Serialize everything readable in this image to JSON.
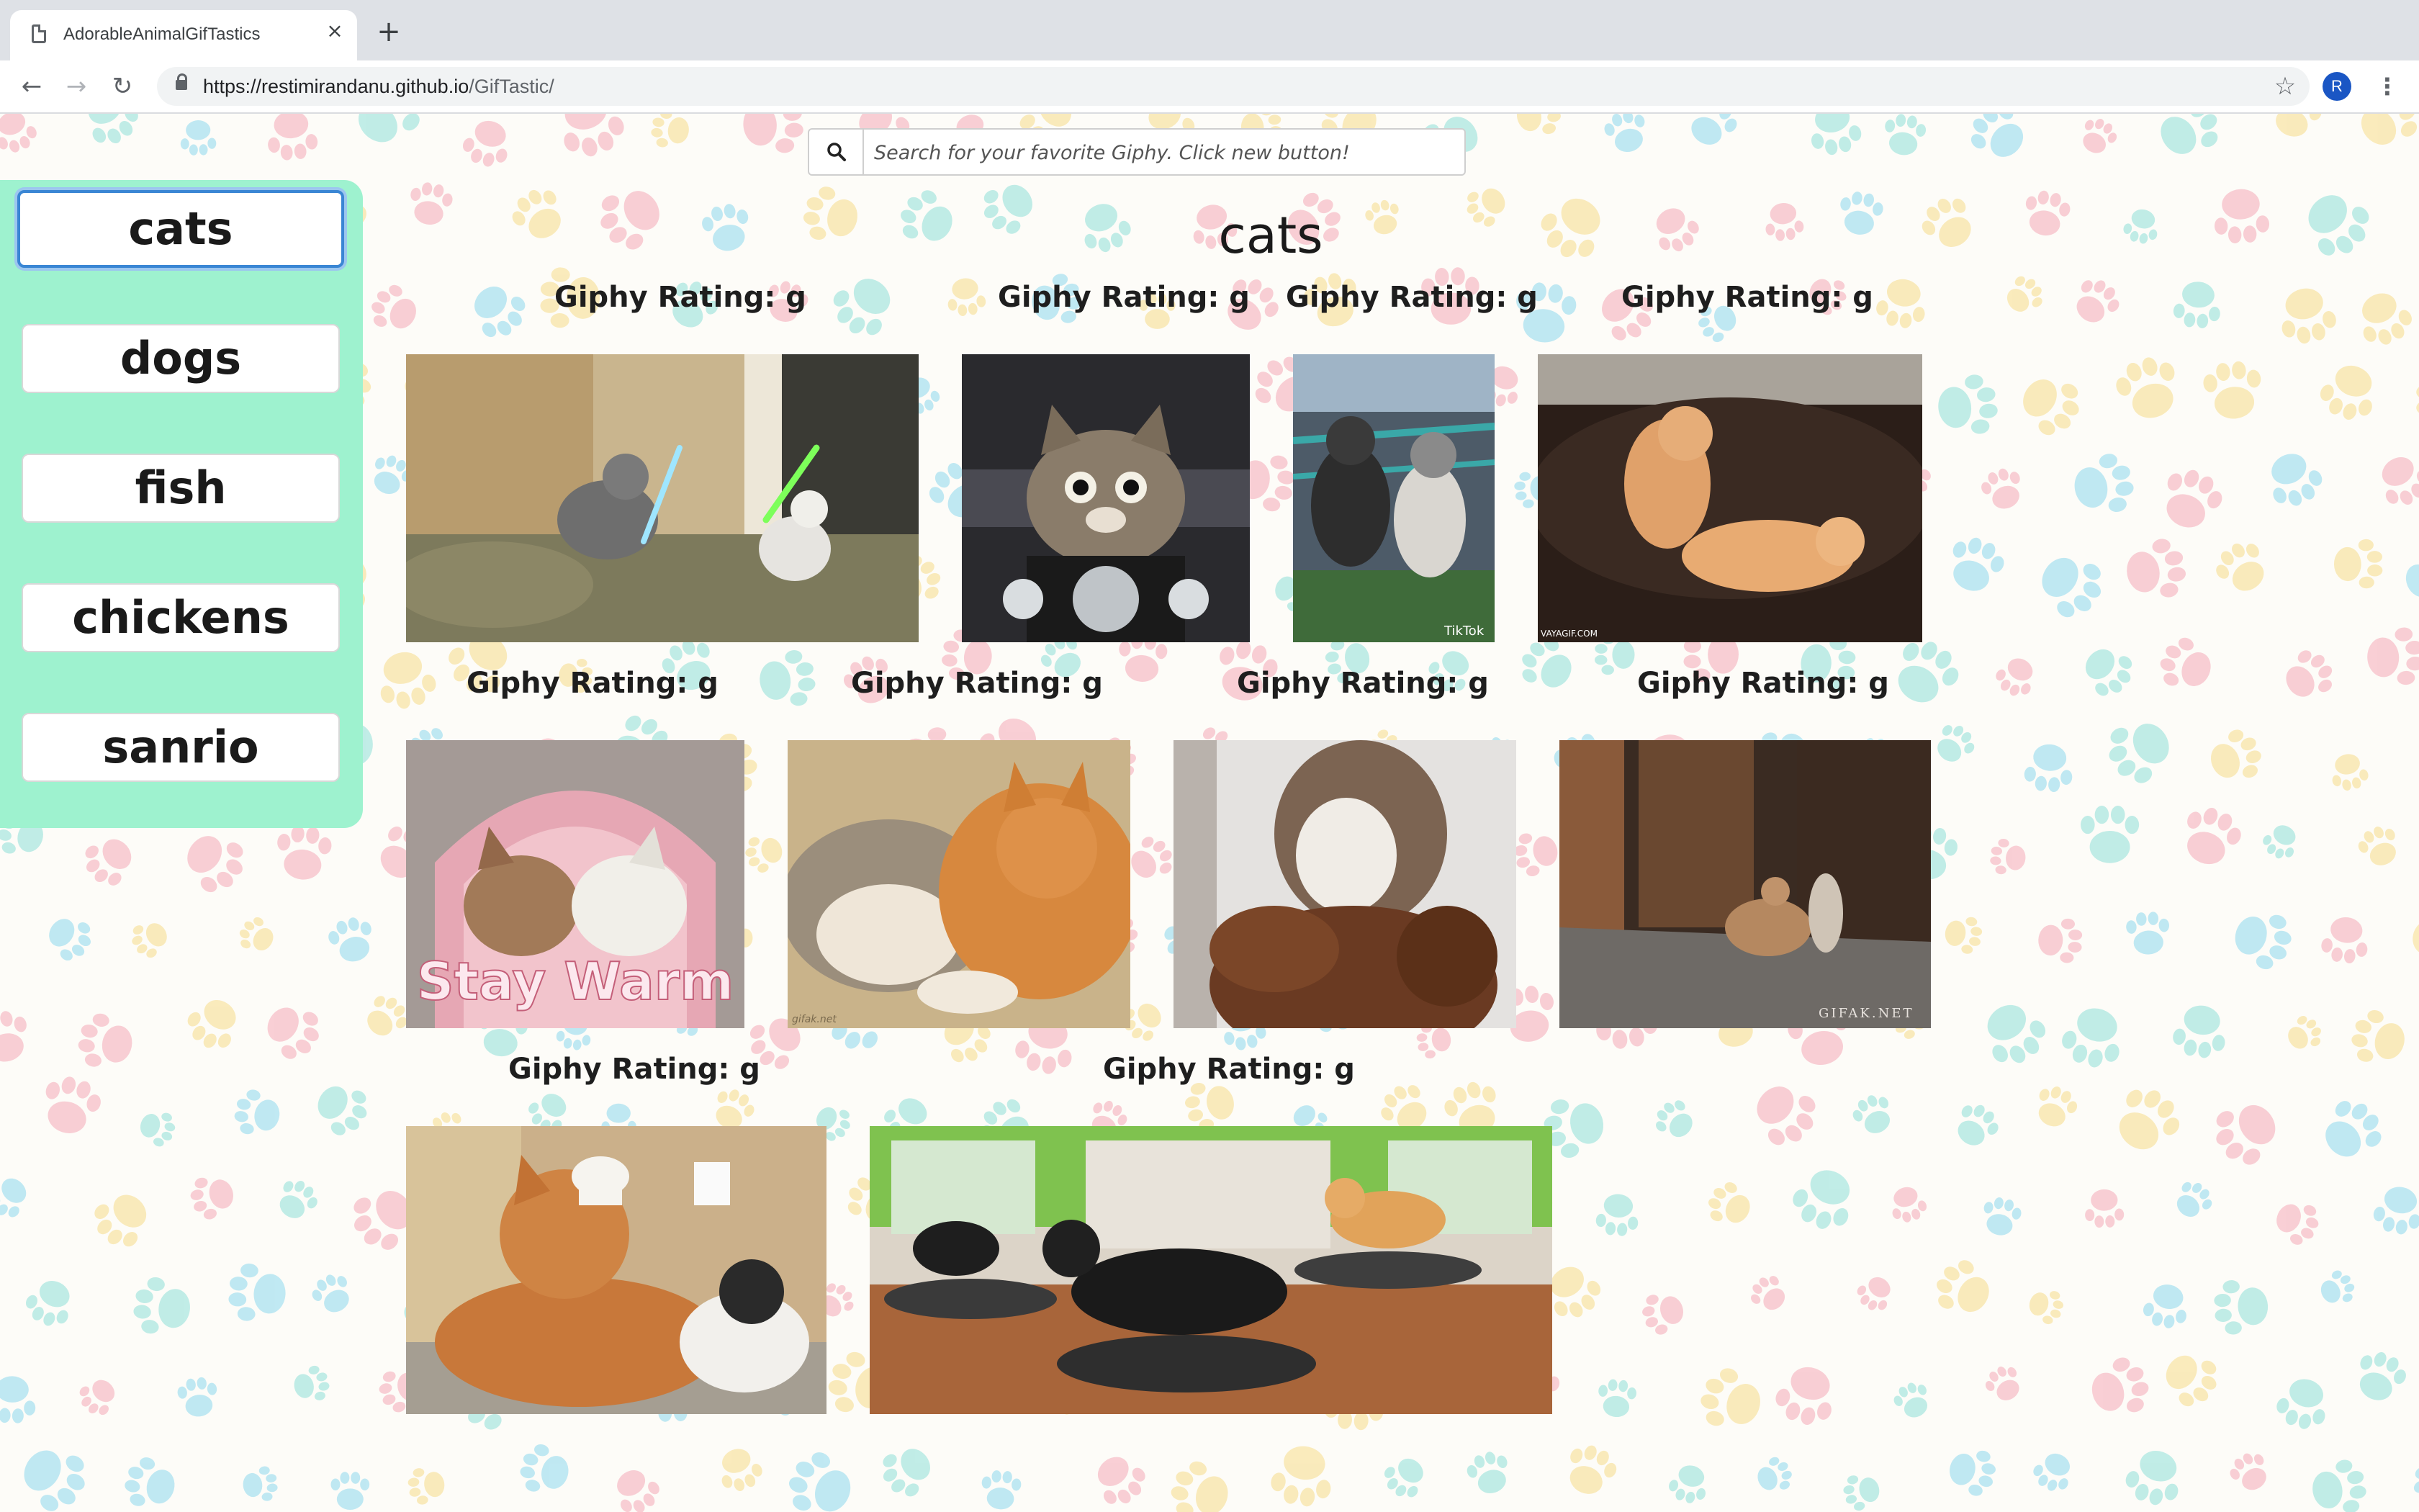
{
  "browser": {
    "tab_title": "AdorableAnimalGifTastics",
    "close_glyph": "×",
    "new_tab_glyph": "+",
    "back_glyph": "←",
    "forward_glyph": "→",
    "reload_glyph": "↻",
    "url_host": "https://restimirandanu.github.io",
    "url_path": "/GifTastic/",
    "bookmark_glyph": "☆",
    "profile_initial": "R",
    "menu_glyph": "⋮"
  },
  "search": {
    "placeholder": "Search for your favorite Giphy. Click new button!",
    "value": ""
  },
  "sidebar": {
    "buttons": [
      {
        "label": "cats",
        "active": true
      },
      {
        "label": "dogs"
      },
      {
        "label": "fish"
      },
      {
        "label": "chickens"
      },
      {
        "label": "sanrio"
      }
    ]
  },
  "main": {
    "title": "cats",
    "gifs": [
      {
        "rating_label": "Giphy Rating: g",
        "description": "two kittens lightsaber duel on couch"
      },
      {
        "rating_label": "Giphy Rating: g",
        "description": "kitten riding motorcycle"
      },
      {
        "rating_label": "Giphy Rating: g",
        "description": "kittens on fence",
        "watermark": "TikTok"
      },
      {
        "rating_label": "Giphy Rating: g",
        "description": "cats wrestling on leather couch",
        "watermark": "VAYAGIF.COM"
      },
      {
        "rating_label": "Giphy Rating: g",
        "description": "cats in pink hoodie",
        "caption": "Stay Warm"
      },
      {
        "rating_label": "Giphy Rating: g",
        "description": "cat kneading orange cat",
        "watermark": "gifak.net"
      },
      {
        "rating_label": "Giphy Rating: g",
        "description": "cat jumping on teddy bear"
      },
      {
        "rating_label": "Giphy Rating: g",
        "description": "cat slipping in hallway",
        "watermark": "GIFAK.NET"
      },
      {
        "rating_label": "Giphy Rating: g",
        "description": "orange cat with chef hat"
      },
      {
        "rating_label": "Giphy Rating: g",
        "description": "cats on balance boards"
      }
    ]
  },
  "colors": {
    "sidebar_bg": "#9ef2cf",
    "active_button_border": "#3a86d4",
    "paw_pink": "#f5a9b8",
    "paw_yellow": "#f7dc8a",
    "paw_blue": "#8ed8ee",
    "paw_teal": "#8fe0d8"
  }
}
